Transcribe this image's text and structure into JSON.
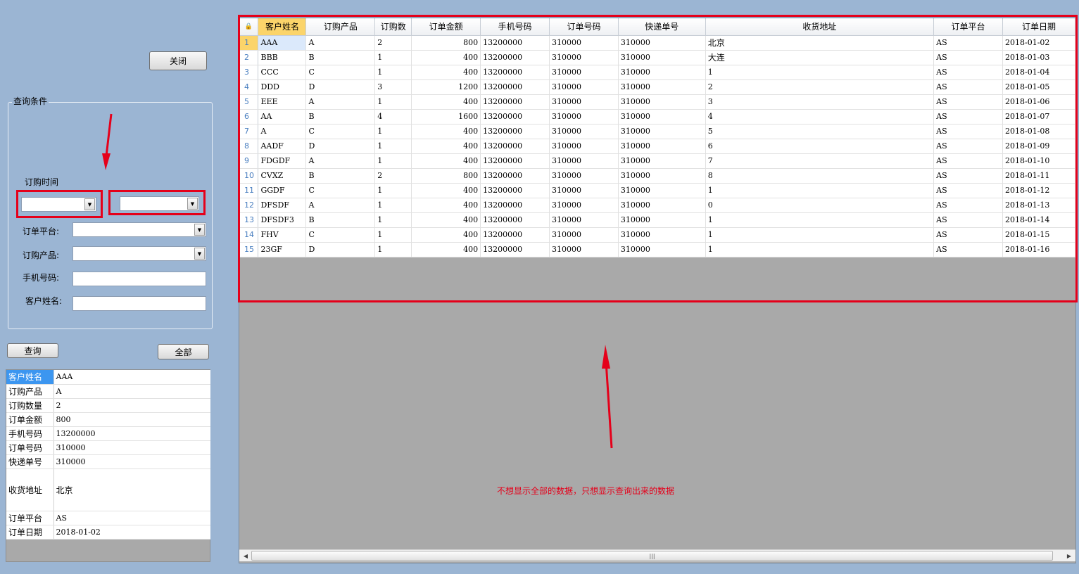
{
  "buttons": {
    "close": "关闭",
    "query": "查询",
    "all": "全部"
  },
  "query_group": {
    "title": "查询条件",
    "order_time_label": "订购时间",
    "platform_label": "订单平台:",
    "product_label": "订购产品:",
    "phone_label": "手机号码:",
    "name_label": "客户姓名:",
    "order_time_from": "",
    "order_time_to": "",
    "platform_value": "",
    "product_value": "",
    "phone_value": "",
    "name_value": ""
  },
  "detail": [
    {
      "key": "客户姓名",
      "value": "AAA"
    },
    {
      "key": "订购产品",
      "value": "A"
    },
    {
      "key": "订购数量",
      "value": "2"
    },
    {
      "key": "订单金额",
      "value": "800"
    },
    {
      "key": "手机号码",
      "value": "13200000"
    },
    {
      "key": "订单号码",
      "value": "310000"
    },
    {
      "key": "快递单号",
      "value": "310000"
    },
    {
      "key": "收货地址",
      "value": "北京"
    },
    {
      "key": "订单平台",
      "value": "AS"
    },
    {
      "key": "订单日期",
      "value": "2018-01-02"
    }
  ],
  "grid": {
    "columns": [
      "客户姓名",
      "订购产品",
      "订购数",
      "订单金额",
      "手机号码",
      "订单号码",
      "快递单号",
      "收货地址",
      "订单平台",
      "订单日期"
    ],
    "rows": [
      [
        "AAA",
        "A",
        "2",
        "800",
        "13200000",
        "310000",
        "310000",
        "北京",
        "AS",
        "2018-01-02"
      ],
      [
        "BBB",
        "B",
        "1",
        "400",
        "13200000",
        "310000",
        "310000",
        "大连",
        "AS",
        "2018-01-03"
      ],
      [
        "CCC",
        "C",
        "1",
        "400",
        "13200000",
        "310000",
        "310000",
        "1",
        "AS",
        "2018-01-04"
      ],
      [
        "DDD",
        "D",
        "3",
        "1200",
        "13200000",
        "310000",
        "310000",
        "2",
        "AS",
        "2018-01-05"
      ],
      [
        "EEE",
        "A",
        "1",
        "400",
        "13200000",
        "310000",
        "310000",
        "3",
        "AS",
        "2018-01-06"
      ],
      [
        "AA",
        "B",
        "4",
        "1600",
        "13200000",
        "310000",
        "310000",
        "4",
        "AS",
        "2018-01-07"
      ],
      [
        "A",
        "C",
        "1",
        "400",
        "13200000",
        "310000",
        "310000",
        "5",
        "AS",
        "2018-01-08"
      ],
      [
        "AADF",
        "D",
        "1",
        "400",
        "13200000",
        "310000",
        "310000",
        "6",
        "AS",
        "2018-01-09"
      ],
      [
        "FDGDF",
        "A",
        "1",
        "400",
        "13200000",
        "310000",
        "310000",
        "7",
        "AS",
        "2018-01-10"
      ],
      [
        "CVXZ",
        "B",
        "2",
        "800",
        "13200000",
        "310000",
        "310000",
        "8",
        "AS",
        "2018-01-11"
      ],
      [
        "GGDF",
        "C",
        "1",
        "400",
        "13200000",
        "310000",
        "310000",
        "1",
        "AS",
        "2018-01-12"
      ],
      [
        "DFSDF",
        "A",
        "1",
        "400",
        "13200000",
        "310000",
        "310000",
        "0",
        "AS",
        "2018-01-13"
      ],
      [
        "DFSDF3",
        "B",
        "1",
        "400",
        "13200000",
        "310000",
        "310000",
        "1",
        "AS",
        "2018-01-14"
      ],
      [
        "FHV",
        "C",
        "1",
        "400",
        "13200000",
        "310000",
        "310000",
        "1",
        "AS",
        "2018-01-15"
      ],
      [
        "23GF",
        "D",
        "1",
        "400",
        "13200000",
        "310000",
        "310000",
        "1",
        "AS",
        "2018-01-16"
      ]
    ]
  },
  "annotation": "不想显示全部的数据，只想显示查询出来的数据",
  "colors": {
    "background": "#9bb5d3",
    "annotation_red": "#e5001a",
    "selected_header": "#fbd46a",
    "selected_key": "#3c96f0"
  }
}
